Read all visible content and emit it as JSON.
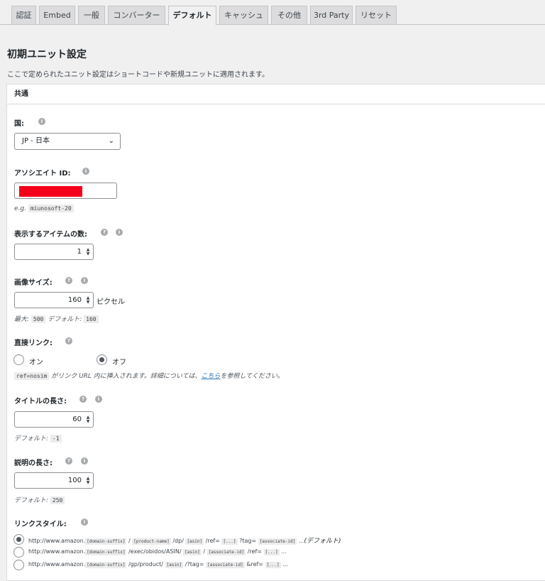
{
  "tabs": [
    {
      "label": "認証",
      "active": false
    },
    {
      "label": "Embed",
      "active": false
    },
    {
      "label": "一般",
      "active": false
    },
    {
      "label": "コンバーター",
      "active": false
    },
    {
      "label": "デフォルト",
      "active": true
    },
    {
      "label": "キャッシュ",
      "active": false
    },
    {
      "label": "その他",
      "active": false
    },
    {
      "label": "3rd Party",
      "active": false
    },
    {
      "label": "リセット",
      "active": false
    }
  ],
  "section": {
    "title": "初期ユニット設定",
    "description": "ここで定められたユニット設定はショートコードや新規ユニットに適用されます。"
  },
  "panel": {
    "heading": "共通"
  },
  "help_icon": "?",
  "info_icon": "i",
  "country": {
    "label": "国:",
    "value": "JP - 日本"
  },
  "associate": {
    "label": "アソシエイト ID:",
    "eg_prefix": "e.g.",
    "eg_value": "miunosoft-20"
  },
  "items": {
    "label": "表示するアイテムの数:",
    "value": "1"
  },
  "image_size": {
    "label": "画像サイズ:",
    "value": "160",
    "unit": "ピクセル",
    "max_label": "最大:",
    "max_value": "500",
    "default_label": "デフォルト:",
    "default_value": "160"
  },
  "direct_link": {
    "label": "直接リンク:",
    "on_label": "オン",
    "off_label": "オフ",
    "selected": "off",
    "note_code": "ref=nosim",
    "note_text": " がリンク URL 内に挿入されます。詳細については、",
    "note_link": "こちら",
    "note_suffix": "を参照してください。"
  },
  "title_length": {
    "label": "タイトルの長さ:",
    "value": "60",
    "default_label": "デフォルト:",
    "default_value": "-1"
  },
  "desc_length": {
    "label": "説明の長さ:",
    "value": "100",
    "default_label": "デフォルト:",
    "default_value": "250"
  },
  "link_style": {
    "label": "リンクスタイル:",
    "default_suffix": "(デフォルト)",
    "options": [
      {
        "selected": true,
        "parts": [
          "http://www.amazon.",
          "[domain-suffix]",
          " / ",
          "[product-name]",
          " /dp/ ",
          "[asin]",
          " /ref= ",
          "[...]",
          " ?tag= ",
          "[associate-id]",
          " ..."
        ]
      },
      {
        "selected": false,
        "parts": [
          "http://www.amazon.",
          "[domain-suffix]",
          " /exec/obidos/ASIN/ ",
          "[asin]",
          " / ",
          "[associate-id]",
          " /ref= ",
          "[...]",
          " ..."
        ]
      },
      {
        "selected": false,
        "parts": [
          "http://www.amazon.",
          "[domain-suffix]",
          " /gp/product/ ",
          "[asin]",
          " /?tag= ",
          "[associate-id]",
          " &ref= ",
          "[...]",
          " ..."
        ]
      }
    ]
  }
}
